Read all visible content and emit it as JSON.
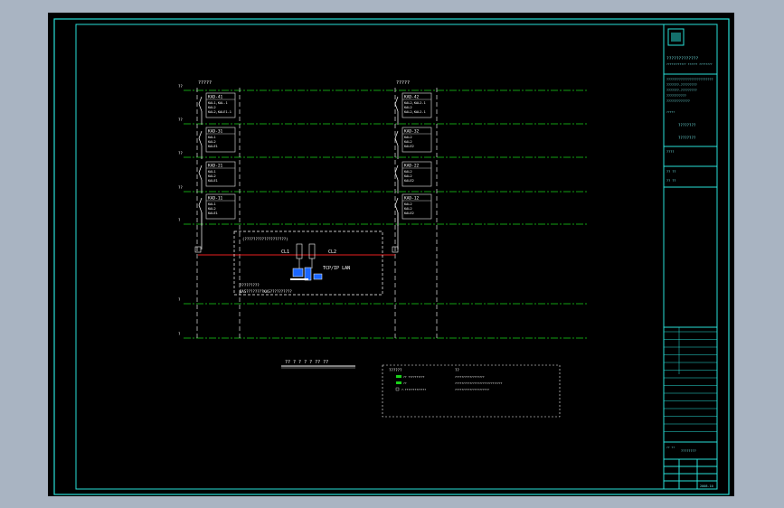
{
  "drawing": {
    "column_labels": [
      "?????",
      "?????"
    ],
    "floor_labels": [
      "??",
      "??",
      "??",
      "??",
      "?",
      "?",
      "?"
    ],
    "left_column": [
      {
        "tag": "KAD-41",
        "lines": [
          "KAL1,KAL-1",
          "KAL2",
          "KAL2,KALE1-1"
        ]
      },
      {
        "tag": "KAD-31",
        "lines": [
          "KAL1",
          "KAL2",
          "KALE1"
        ]
      },
      {
        "tag": "KAD-21",
        "lines": [
          "KAL1",
          "KAL2",
          "KALE1"
        ]
      },
      {
        "tag": "KAD-11",
        "lines": [
          "KAL1",
          "KAL2",
          "KALE1"
        ]
      }
    ],
    "right_column": [
      {
        "tag": "KAD-42",
        "lines": [
          "KAL2,KAL2-1",
          "KAL2",
          "KAL2,KAL2-1"
        ]
      },
      {
        "tag": "KAD-32",
        "lines": [
          "KAL2",
          "KAL2",
          "KALE2"
        ]
      },
      {
        "tag": "KAD-22",
        "lines": [
          "KAL2",
          "KAL2",
          "KALE2"
        ]
      },
      {
        "tag": "KAD-12",
        "lines": [
          "KAL2",
          "KAL2",
          "KALE2"
        ]
      }
    ],
    "control_room": {
      "title": "(???????????????????)",
      "bus_left": "CL1",
      "bus_right": "CL2",
      "network": "TCP/IP LAN",
      "tag": "?????????",
      "footer": "BAS????????KAS??????????"
    },
    "diagram_title": "?? ? ? ? ?  ?? ??",
    "legend": {
      "header_left": "??????",
      "header_right": "??",
      "rows": [
        {
          "sym": "?? ??????????",
          "desc": "??????????????????"
        },
        {
          "sym": "??",
          "desc": "?????????????????????????????"
        },
        {
          "sym": "?-?????????????",
          "desc": "?????????????????????"
        }
      ]
    }
  },
  "title_block": {
    "company_cn": "?????????????",
    "company_en": "???????????? ?????? ????????",
    "project_lines": [
      "??????????????????????????",
      "???????-?????????",
      "???????-?????????",
      "???????????",
      "?????????????"
    ],
    "drawing_name": "????????",
    "fields": [
      "?? ??",
      "??  ??"
    ],
    "revision": "?? ??",
    "sheet": "????",
    "date": "2008.10"
  },
  "colors": {
    "frame": "#28e0d8",
    "axis": "#19d219",
    "bus": "#e82020",
    "wire": "#ffffff",
    "equipment_frame": "#c8c8c8"
  }
}
